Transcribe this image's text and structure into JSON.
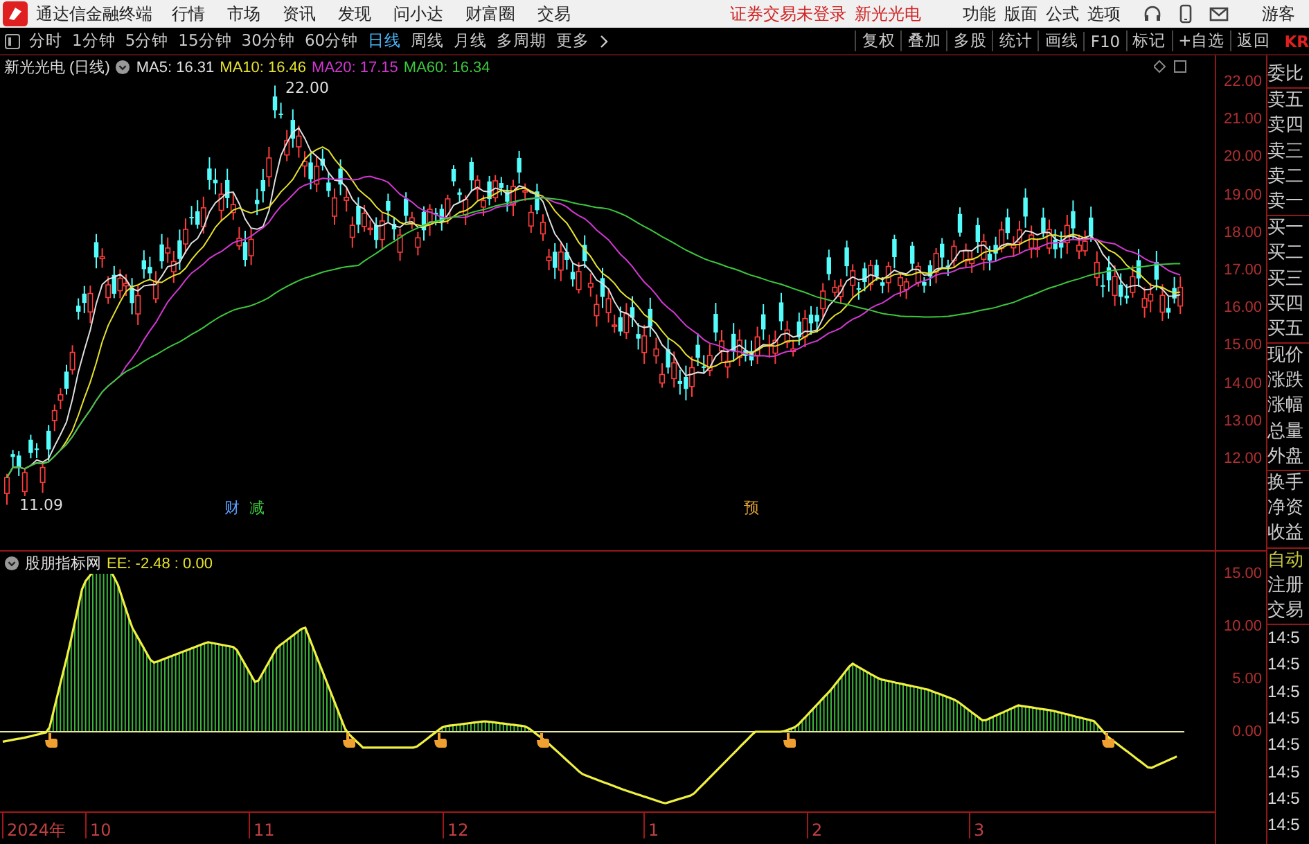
{
  "title_bar": {
    "app_name": "通达信金融终端",
    "menus": [
      "行情",
      "市场",
      "资讯",
      "发现",
      "问小达",
      "财富圈",
      "交易"
    ],
    "notice": "证券交易未登录",
    "stock_name": "新光光电",
    "tools": [
      "功能",
      "版面",
      "公式",
      "选项"
    ],
    "user": "游客"
  },
  "toolbar": {
    "periods": [
      {
        "label": "分时",
        "selected": false
      },
      {
        "label": "1分钟",
        "selected": false
      },
      {
        "label": "5分钟",
        "selected": false
      },
      {
        "label": "15分钟",
        "selected": false
      },
      {
        "label": "30分钟",
        "selected": false
      },
      {
        "label": "60分钟",
        "selected": false
      },
      {
        "label": "日线",
        "selected": true
      },
      {
        "label": "周线",
        "selected": false
      },
      {
        "label": "月线",
        "selected": false
      },
      {
        "label": "多周期",
        "selected": false
      }
    ],
    "more": "更多",
    "actions": [
      "复权",
      "叠加",
      "多股",
      "统计",
      "画线",
      "F10",
      "标记",
      "+自选",
      "返回"
    ],
    "corner": "KR"
  },
  "main_chart": {
    "title": "新光光电 (日线)",
    "ma": [
      {
        "label": "MA5: 16.31",
        "color": "#e0e0e0"
      },
      {
        "label": "MA10: 16.46",
        "color": "#e6e22e"
      },
      {
        "label": "MA20: 17.15",
        "color": "#d238d2"
      },
      {
        "label": "MA60: 16.34",
        "color": "#3cc83c"
      }
    ],
    "high_label": "22.00",
    "low_label": "11.09",
    "events": [
      {
        "text": "财",
        "color": "#5aa0ff"
      },
      {
        "text": "减",
        "color": "#3cc83c"
      },
      {
        "text": "预",
        "color": "#e0a030"
      }
    ],
    "y_axis": [
      "22.00",
      "21.00",
      "20.00",
      "19.00",
      "18.00",
      "17.00",
      "16.00",
      "15.00",
      "14.00",
      "13.00",
      "12.00"
    ]
  },
  "indicator": {
    "name": "股朋指标网",
    "values": "EE: -2.48 : 0.00",
    "y_axis": [
      "15.00",
      "10.00",
      "5.00",
      "0.00"
    ]
  },
  "x_axis": [
    "2024年",
    "10",
    "11",
    "12",
    "1",
    "2",
    "3"
  ],
  "quote_panel": {
    "groups": [
      [
        {
          "label": "委比",
          "kind": "field"
        }
      ],
      [
        {
          "label": "卖五",
          "kind": "field"
        },
        {
          "label": "卖四",
          "kind": "field"
        },
        {
          "label": "卖三",
          "kind": "field"
        },
        {
          "label": "卖二",
          "kind": "field"
        },
        {
          "label": "卖一",
          "kind": "field"
        }
      ],
      [
        {
          "label": "买一",
          "kind": "field"
        },
        {
          "label": "买二",
          "kind": "field"
        },
        {
          "label": "买三",
          "kind": "field"
        },
        {
          "label": "买四",
          "kind": "field"
        },
        {
          "label": "买五",
          "kind": "field"
        }
      ],
      [
        {
          "label": "现价",
          "kind": "field"
        },
        {
          "label": "涨跌",
          "kind": "field"
        },
        {
          "label": "涨幅",
          "kind": "field"
        },
        {
          "label": "总量",
          "kind": "field"
        },
        {
          "label": "外盘",
          "kind": "field"
        }
      ],
      [
        {
          "label": "换手",
          "kind": "field"
        },
        {
          "label": "净资",
          "kind": "field"
        },
        {
          "label": "收益",
          "kind": "field"
        }
      ],
      [
        {
          "label": "自动",
          "kind": "toggle"
        },
        {
          "label": "注册",
          "kind": "field"
        },
        {
          "label": "交易",
          "kind": "field"
        }
      ]
    ],
    "times": [
      "14:5",
      "14:5",
      "14:5",
      "14:5",
      "14:5",
      "14:5",
      "14:5",
      "14:5"
    ]
  }
}
